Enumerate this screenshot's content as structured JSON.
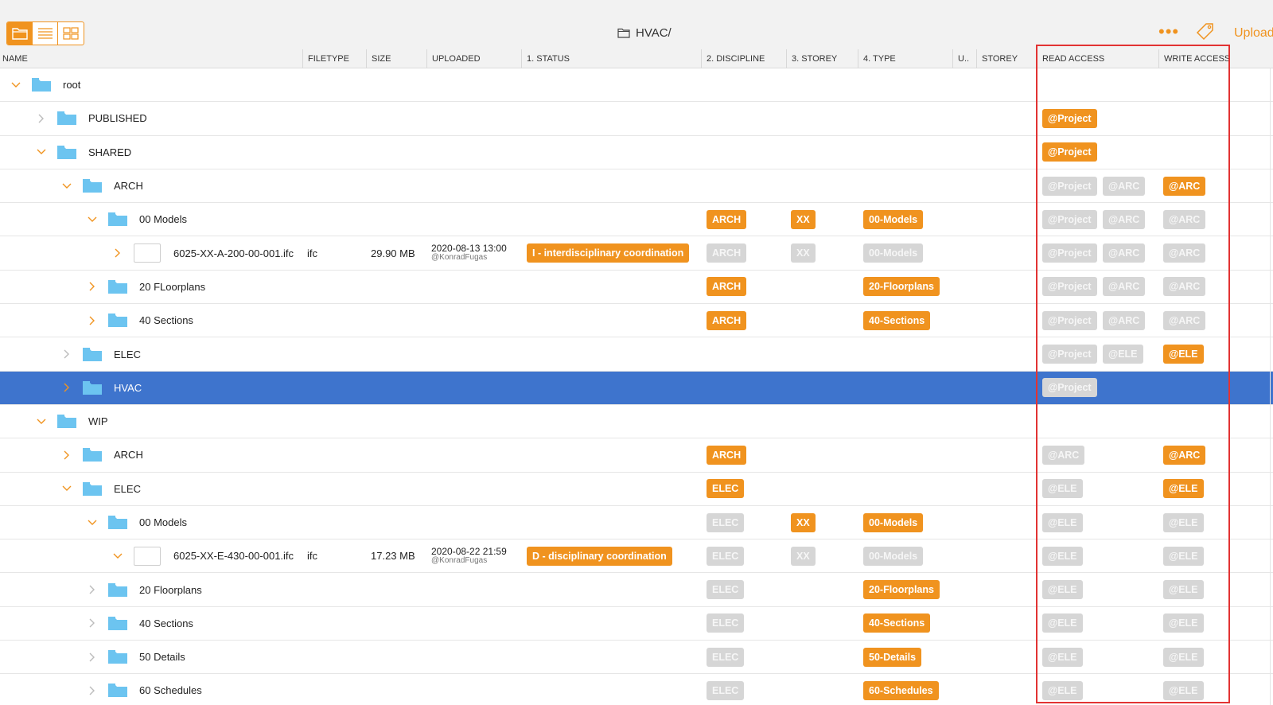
{
  "toolbar": {
    "views": [
      {
        "icon": "folder-view-icon",
        "active": true
      },
      {
        "icon": "list-view-icon",
        "active": false
      },
      {
        "icon": "grid-view-icon",
        "active": false
      }
    ],
    "path": "HVAC/",
    "more_label": "•••",
    "upload_label": "Upload"
  },
  "columns": [
    "NAME",
    "FILETYPE",
    "SIZE",
    "UPLOADED",
    "1. STATUS",
    "2. DISCIPLINE",
    "3. STOREY",
    "4. TYPE",
    "U..",
    "STOREY",
    "READ ACCESS",
    "WRITE ACCESS"
  ],
  "colors": {
    "accent": "#f0931f",
    "selected": "#3e74cd",
    "folder": "#6cc4f0",
    "highlight": "#e23333"
  },
  "rows": [
    {
      "name": "root",
      "level": 0,
      "kind": "folder",
      "chev": "down"
    },
    {
      "name": "PUBLISHED",
      "level": 1,
      "kind": "folder",
      "chev": "right-grey",
      "read": [
        {
          "t": "@Project",
          "c": "orange"
        }
      ]
    },
    {
      "name": "SHARED",
      "level": 1,
      "kind": "folder",
      "chev": "down",
      "read": [
        {
          "t": "@Project",
          "c": "orange"
        }
      ]
    },
    {
      "name": "ARCH",
      "level": 2,
      "kind": "folder",
      "chev": "down",
      "read": [
        {
          "t": "@Project",
          "c": "grey"
        },
        {
          "t": "@ARC",
          "c": "grey"
        }
      ],
      "write": [
        {
          "t": "@ARC",
          "c": "orange"
        }
      ]
    },
    {
      "name": "00 Models",
      "level": 3,
      "kind": "folder",
      "chev": "down",
      "discipline": {
        "t": "ARCH",
        "c": "orange"
      },
      "storey": {
        "t": "XX",
        "c": "orange"
      },
      "type": {
        "t": "00-Models",
        "c": "orange"
      },
      "read": [
        {
          "t": "@Project",
          "c": "grey"
        },
        {
          "t": "@ARC",
          "c": "grey"
        }
      ],
      "write": [
        {
          "t": "@ARC",
          "c": "grey"
        }
      ]
    },
    {
      "name": "6025-XX-A-200-00-001.ifc",
      "level": 4,
      "kind": "file",
      "chev": "right",
      "filetype": "ifc",
      "size": "29.90 MB",
      "uploaded": "2020-08-13 13:00",
      "uploader": "@KonradFugas",
      "status": {
        "t": "I - interdisciplinary coordination",
        "c": "orange"
      },
      "discipline": {
        "t": "ARCH",
        "c": "grey"
      },
      "storey": {
        "t": "XX",
        "c": "grey"
      },
      "type": {
        "t": "00-Models",
        "c": "grey"
      },
      "read": [
        {
          "t": "@Project",
          "c": "grey"
        },
        {
          "t": "@ARC",
          "c": "grey"
        }
      ],
      "write": [
        {
          "t": "@ARC",
          "c": "grey"
        }
      ]
    },
    {
      "name": "20 FLoorplans",
      "level": 3,
      "kind": "folder",
      "chev": "right",
      "discipline": {
        "t": "ARCH",
        "c": "orange"
      },
      "type": {
        "t": "20-Floorplans",
        "c": "orange"
      },
      "read": [
        {
          "t": "@Project",
          "c": "grey"
        },
        {
          "t": "@ARC",
          "c": "grey"
        }
      ],
      "write": [
        {
          "t": "@ARC",
          "c": "grey"
        }
      ]
    },
    {
      "name": "40 Sections",
      "level": 3,
      "kind": "folder",
      "chev": "right",
      "discipline": {
        "t": "ARCH",
        "c": "orange"
      },
      "type": {
        "t": "40-Sections",
        "c": "orange"
      },
      "read": [
        {
          "t": "@Project",
          "c": "grey"
        },
        {
          "t": "@ARC",
          "c": "grey"
        }
      ],
      "write": [
        {
          "t": "@ARC",
          "c": "grey"
        }
      ]
    },
    {
      "name": "ELEC",
      "level": 2,
      "kind": "folder",
      "chev": "right-grey",
      "read": [
        {
          "t": "@Project",
          "c": "grey"
        },
        {
          "t": "@ELE",
          "c": "grey"
        }
      ],
      "write": [
        {
          "t": "@ELE",
          "c": "orange"
        }
      ]
    },
    {
      "name": "HVAC",
      "level": 2,
      "kind": "folder",
      "chev": "right",
      "selected": true,
      "read": [
        {
          "t": "@Project",
          "c": "grey"
        }
      ]
    },
    {
      "name": "WIP",
      "level": 1,
      "kind": "folder",
      "chev": "down"
    },
    {
      "name": "ARCH",
      "level": 2,
      "kind": "folder",
      "chev": "right",
      "discipline": {
        "t": "ARCH",
        "c": "orange"
      },
      "read": [
        {
          "t": "@ARC",
          "c": "grey"
        }
      ],
      "write": [
        {
          "t": "@ARC",
          "c": "orange"
        }
      ]
    },
    {
      "name": "ELEC",
      "level": 2,
      "kind": "folder",
      "chev": "down",
      "discipline": {
        "t": "ELEC",
        "c": "orange"
      },
      "read": [
        {
          "t": "@ELE",
          "c": "grey"
        }
      ],
      "write": [
        {
          "t": "@ELE",
          "c": "orange"
        }
      ]
    },
    {
      "name": "00 Models",
      "level": 3,
      "kind": "folder",
      "chev": "down",
      "discipline": {
        "t": "ELEC",
        "c": "grey"
      },
      "storey": {
        "t": "XX",
        "c": "orange"
      },
      "type": {
        "t": "00-Models",
        "c": "orange"
      },
      "read": [
        {
          "t": "@ELE",
          "c": "grey"
        }
      ],
      "write": [
        {
          "t": "@ELE",
          "c": "grey"
        }
      ]
    },
    {
      "name": "6025-XX-E-430-00-001.ifc",
      "level": 4,
      "kind": "file",
      "chev": "down",
      "filetype": "ifc",
      "size": "17.23 MB",
      "uploaded": "2020-08-22 21:59",
      "uploader": "@KonradFugas",
      "status": {
        "t": "D - disciplinary coordination",
        "c": "orange"
      },
      "discipline": {
        "t": "ELEC",
        "c": "grey"
      },
      "storey": {
        "t": "XX",
        "c": "grey"
      },
      "type": {
        "t": "00-Models",
        "c": "grey"
      },
      "read": [
        {
          "t": "@ELE",
          "c": "grey"
        }
      ],
      "write": [
        {
          "t": "@ELE",
          "c": "grey"
        }
      ]
    },
    {
      "name": "20 Floorplans",
      "level": 3,
      "kind": "folder",
      "chev": "right-grey",
      "discipline": {
        "t": "ELEC",
        "c": "grey"
      },
      "type": {
        "t": "20-Floorplans",
        "c": "orange"
      },
      "read": [
        {
          "t": "@ELE",
          "c": "grey"
        }
      ],
      "write": [
        {
          "t": "@ELE",
          "c": "grey"
        }
      ]
    },
    {
      "name": "40 Sections",
      "level": 3,
      "kind": "folder",
      "chev": "right-grey",
      "discipline": {
        "t": "ELEC",
        "c": "grey"
      },
      "type": {
        "t": "40-Sections",
        "c": "orange"
      },
      "read": [
        {
          "t": "@ELE",
          "c": "grey"
        }
      ],
      "write": [
        {
          "t": "@ELE",
          "c": "grey"
        }
      ]
    },
    {
      "name": "50 Details",
      "level": 3,
      "kind": "folder",
      "chev": "right-grey",
      "discipline": {
        "t": "ELEC",
        "c": "grey"
      },
      "type": {
        "t": "50-Details",
        "c": "orange"
      },
      "read": [
        {
          "t": "@ELE",
          "c": "grey"
        }
      ],
      "write": [
        {
          "t": "@ELE",
          "c": "grey"
        }
      ]
    },
    {
      "name": "60 Schedules",
      "level": 3,
      "kind": "folder",
      "chev": "right-grey",
      "discipline": {
        "t": "ELEC",
        "c": "grey"
      },
      "type": {
        "t": "60-Schedules",
        "c": "orange"
      },
      "read": [
        {
          "t": "@ELE",
          "c": "grey"
        }
      ],
      "write": [
        {
          "t": "@ELE",
          "c": "grey"
        }
      ]
    }
  ]
}
